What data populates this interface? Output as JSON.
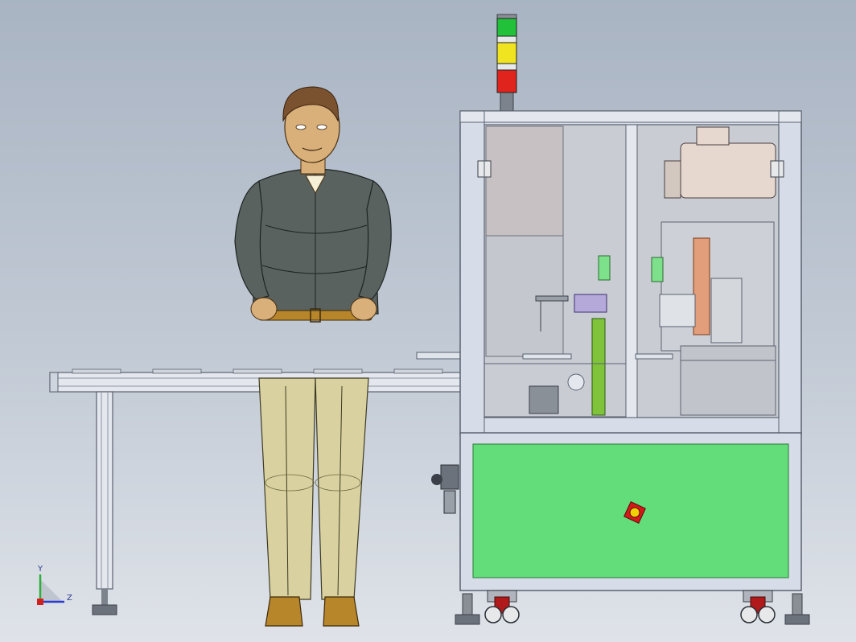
{
  "scene": {
    "axes": {
      "y_label": "Y",
      "z_label": "Z"
    },
    "stack_light": {
      "colors": [
        "#21c23a",
        "#f0e320",
        "#e0231c"
      ]
    },
    "palette": {
      "frame": "#d7dde8",
      "frame_edge": "#5a6270",
      "panel": "#62dd7a",
      "panel_edge": "#3a8a4a",
      "glass": "#c9ccd3",
      "motor": "#e6d8cf",
      "jacket": "#59625f",
      "pants": "#d9d2a0",
      "shoe": "#b7852a",
      "skin": "#d9b07a"
    }
  }
}
